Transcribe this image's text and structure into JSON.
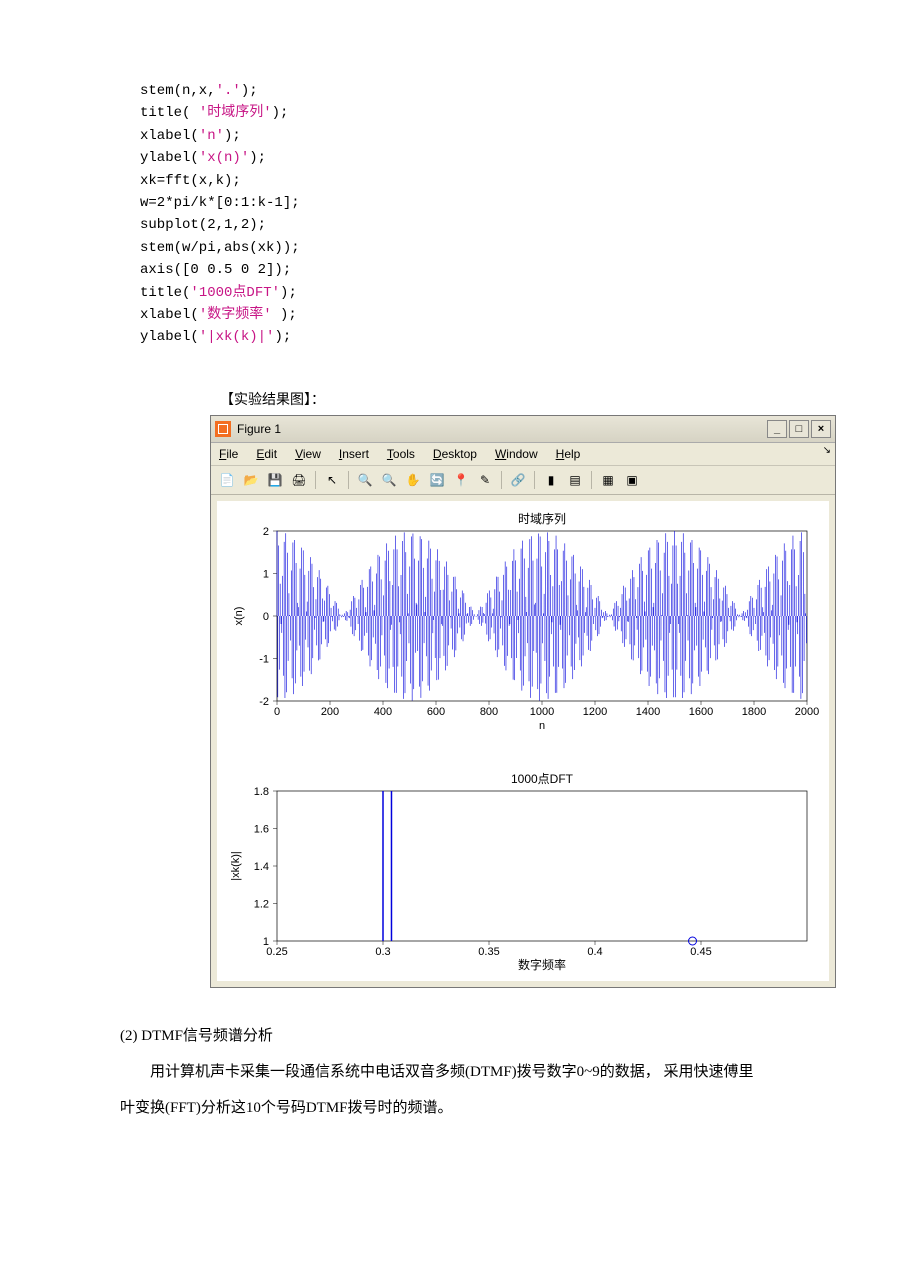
{
  "code": {
    "lines": [
      {
        "parts": [
          {
            "t": "stem(n,x,",
            "c": "norm"
          },
          {
            "t": "'.'",
            "c": "str"
          },
          {
            "t": ");",
            "c": "norm"
          }
        ]
      },
      {
        "parts": [
          {
            "t": "title(",
            "c": "norm"
          },
          {
            "t": " '时域序列'",
            "c": "str"
          },
          {
            "t": ");",
            "c": "norm"
          }
        ]
      },
      {
        "parts": [
          {
            "t": "xlabel(",
            "c": "norm"
          },
          {
            "t": "'n'",
            "c": "str"
          },
          {
            "t": ");",
            "c": "norm"
          }
        ]
      },
      {
        "parts": [
          {
            "t": "ylabel(",
            "c": "norm"
          },
          {
            "t": "'x(n)'",
            "c": "str"
          },
          {
            "t": ");",
            "c": "norm"
          }
        ]
      },
      {
        "parts": [
          {
            "t": "xk=fft(x,k);",
            "c": "norm"
          }
        ]
      },
      {
        "parts": [
          {
            "t": "w=2*pi/k*[0:1:k-1];",
            "c": "norm"
          }
        ]
      },
      {
        "parts": [
          {
            "t": "subplot(2,1,2);",
            "c": "norm"
          }
        ]
      },
      {
        "parts": [
          {
            "t": "stem(w/pi,abs(xk));",
            "c": "norm"
          }
        ]
      },
      {
        "parts": [
          {
            "t": "axis([0 0.5 0 2]);",
            "c": "norm"
          }
        ]
      },
      {
        "parts": [
          {
            "t": "title(",
            "c": "norm"
          },
          {
            "t": "'1000点DFT'",
            "c": "str"
          },
          {
            "t": ");",
            "c": "norm"
          }
        ]
      },
      {
        "parts": [
          {
            "t": "xlabel(",
            "c": "norm"
          },
          {
            "t": "'数字频率'",
            "c": "str"
          },
          {
            "t": " );",
            "c": "norm"
          }
        ]
      },
      {
        "parts": [
          {
            "t": "ylabel(",
            "c": "norm"
          },
          {
            "t": "'|xk(k)|'",
            "c": "str"
          },
          {
            "t": ");",
            "c": "norm"
          }
        ]
      }
    ]
  },
  "section_label": "【实验结果图】：",
  "figure": {
    "title": "Figure 1",
    "menus": [
      "File",
      "Edit",
      "View",
      "Insert",
      "Tools",
      "Desktop",
      "Window",
      "Help"
    ],
    "win_btns": {
      "min": "_",
      "max": "□",
      "close": "×"
    }
  },
  "chart_data": [
    {
      "type": "stem",
      "title": "时域序列",
      "xlabel": "n",
      "ylabel": "x(n)",
      "xlim": [
        0,
        2000
      ],
      "ylim": [
        -2,
        2
      ],
      "xticks": [
        0,
        200,
        400,
        600,
        800,
        1000,
        1200,
        1400,
        1600,
        1800,
        2000
      ],
      "yticks": [
        -2,
        -1,
        0,
        1,
        2
      ],
      "note": "Beating envelope of two close sinusoids; dense blue stems filling envelope with nulls near n≈820 and n≈1650."
    },
    {
      "type": "stem",
      "title": "1000点DFT",
      "xlabel": "数字频率",
      "ylabel": "|xk(k)|",
      "xlim": [
        0.25,
        0.5
      ],
      "ylim": [
        1.0,
        1.8
      ],
      "xticks": [
        0.25,
        0.3,
        0.35,
        0.4,
        0.45
      ],
      "yticks": [
        1,
        1.2,
        1.4,
        1.6,
        1.8
      ],
      "series": [
        {
          "name": "spectrum",
          "x": [
            0.3,
            0.304
          ],
          "y": [
            1.8,
            1.8
          ]
        },
        {
          "name": "marker",
          "x": [
            0.446
          ],
          "y": [
            1.0
          ]
        }
      ]
    }
  ],
  "body": {
    "heading": "(2) DTMF信号频谱分析",
    "p1": "用计算机声卡采集一段通信系统中电话双音多频(DTMF)拨号数字0~9的数据，  采用快速傅里",
    "p2": "叶变换(FFT)分析这10个号码DTMF拨号时的频谱。"
  }
}
